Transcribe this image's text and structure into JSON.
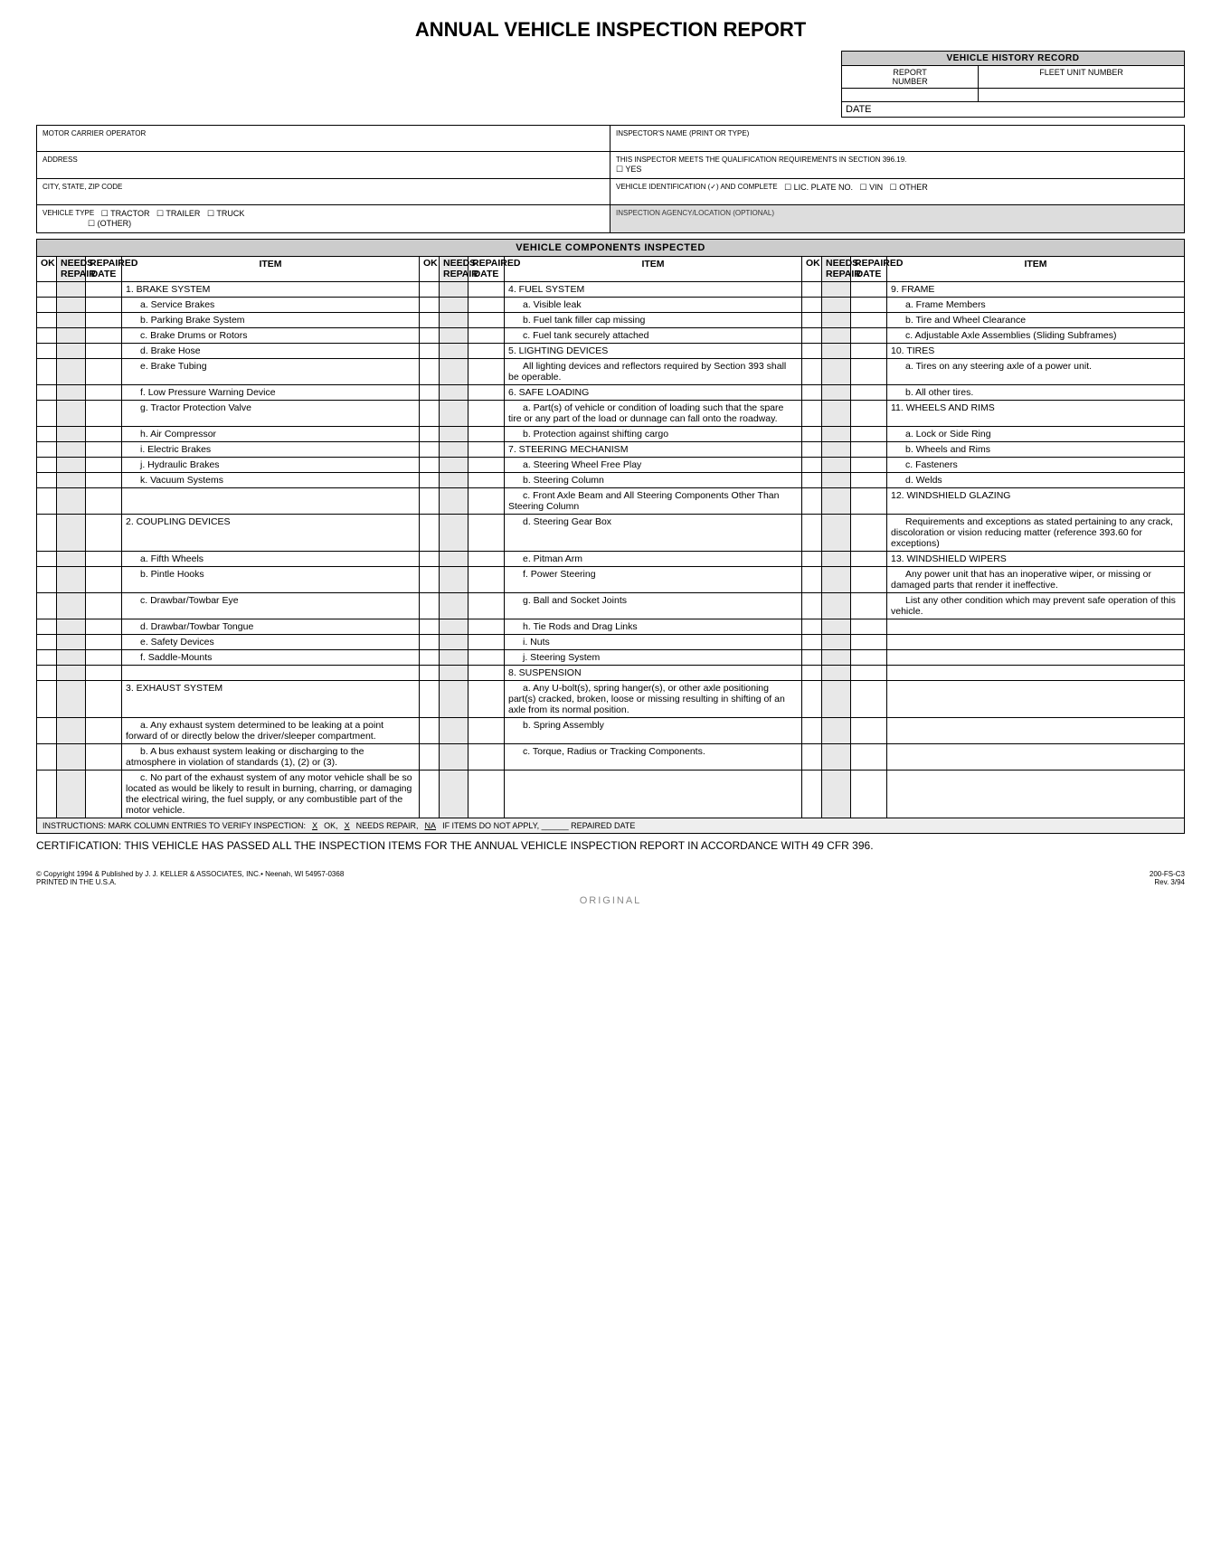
{
  "title": "ANNUAL VEHICLE INSPECTION REPORT",
  "history": {
    "header": "VEHICLE HISTORY RECORD",
    "report_number_label": "REPORT\nNUMBER",
    "fleet_unit_label": "FLEET UNIT NUMBER",
    "date_label": "DATE"
  },
  "top": {
    "motor_carrier": "MOTOR CARRIER OPERATOR",
    "inspector": "INSPECTOR'S NAME (PRINT OR TYPE)",
    "address": "ADDRESS",
    "qual": "THIS INSPECTOR MEETS THE QUALIFICATION REQUIREMENTS IN SECTION 396.19.",
    "yes": "YES",
    "city": "CITY, STATE, ZIP CODE",
    "vid": "VEHICLE IDENTIFICATION (✓) AND COMPLETE",
    "lic": "LIC. PLATE NO.",
    "vin": "VIN",
    "other_id": "OTHER",
    "vtype": "VEHICLE TYPE",
    "tractor": "TRACTOR",
    "trailer": "TRAILER",
    "truck": "TRUCK",
    "other": "(OTHER)",
    "agency": "INSPECTION AGENCY/LOCATION (OPTIONAL)"
  },
  "components_header": "VEHICLE COMPONENTS INSPECTED",
  "col_headers": {
    "ok": "OK",
    "needs": "NEEDS\nREPAIR",
    "repaired": "REPAIRED\nDATE",
    "item": "ITEM"
  },
  "col1": [
    "1. BRAKE SYSTEM",
    "a. Service Brakes",
    "b. Parking Brake System",
    "c. Brake Drums or Rotors",
    "d. Brake Hose",
    "e. Brake Tubing",
    "f. Low Pressure Warning Device",
    "g. Tractor Protection Valve",
    "h. Air Compressor",
    "i. Electric Brakes",
    "j. Hydraulic Brakes",
    "k. Vacuum Systems",
    "",
    "2. COUPLING DEVICES",
    "a. Fifth Wheels",
    "b. Pintle Hooks",
    "c. Drawbar/Towbar Eye",
    "d. Drawbar/Towbar Tongue",
    "e. Safety Devices",
    "f. Saddle-Mounts",
    "",
    "3. EXHAUST SYSTEM",
    "a. Any exhaust system determined to be leaking at a point forward of or directly below the driver/sleeper compartment.",
    "b. A bus exhaust system leaking or discharging to the atmosphere in violation of standards (1), (2) or (3).",
    "c. No part of the exhaust system of any motor vehicle shall be so located as would be likely to result in burning, charring, or damaging the electrical wiring, the fuel supply, or any combustible part of the motor vehicle."
  ],
  "col2": [
    "4. FUEL SYSTEM",
    "a. Visible leak",
    "b. Fuel tank filler cap missing",
    "c. Fuel tank securely attached",
    "5. LIGHTING DEVICES",
    "All lighting devices and reflectors required by Section 393 shall be operable.",
    "6. SAFE LOADING",
    "a. Part(s) of vehicle or condition of loading such that the spare tire or any part of the load or dunnage can fall onto the roadway.",
    "b. Protection against shifting cargo",
    "7. STEERING MECHANISM",
    "a. Steering Wheel Free Play",
    "b. Steering Column",
    "c. Front Axle Beam and All Steering Components Other Than Steering Column",
    "d. Steering Gear Box",
    "e. Pitman Arm",
    "f. Power Steering",
    "g. Ball and Socket Joints",
    "h. Tie Rods and Drag Links",
    "i. Nuts",
    "j. Steering System",
    "8. SUSPENSION",
    "a. Any U-bolt(s), spring hanger(s), or other axle positioning part(s) cracked, broken, loose or missing resulting in shifting of an axle from its normal position.",
    "b. Spring Assembly",
    "c. Torque, Radius or Tracking Components."
  ],
  "col3": [
    "9. FRAME",
    "a. Frame Members",
    "b. Tire and Wheel Clearance",
    "c. Adjustable Axle Assemblies (Sliding Subframes)",
    "10. TIRES",
    "a. Tires on any steering axle of a power unit.",
    "b. All other tires.",
    "11. WHEELS AND RIMS",
    "a. Lock or Side Ring",
    "b. Wheels and Rims",
    "c. Fasteners",
    "d. Welds",
    "12. WINDSHIELD GLAZING",
    "Requirements and exceptions as stated pertaining to any crack, discoloration or vision reducing matter (reference 393.60 for exceptions)",
    "13. WINDSHIELD WIPERS",
    "Any power unit that has an inoperative wiper, or missing or damaged parts that render it ineffective.",
    "List any other condition which may prevent safe operation of this vehicle.",
    "",
    "",
    "",
    "",
    "",
    "",
    ""
  ],
  "instructions": {
    "left": "INSTRUCTIONS: MARK COLUMN ENTRIES TO VERIFY INSPECTION:",
    "x1": "X",
    "ok": "OK,",
    "x2": "X",
    "needs": "NEEDS REPAIR,",
    "na": "NA",
    "if": "IF ITEMS DO NOT APPLY,",
    "rd": "REPAIRED DATE"
  },
  "certification": "CERTIFICATION: THIS VEHICLE HAS PASSED ALL THE INSPECTION ITEMS FOR THE ANNUAL VEHICLE INSPECTION REPORT IN ACCORDANCE WITH 49 CFR 396.",
  "footer": {
    "left": "© Copyright 1994 & Published by J. J. KELLER & ASSOCIATES, INC.• Neenah, WI 54957-0368\nPRINTED IN THE U.S.A.",
    "right": "200-FS-C3\nRev. 3/94"
  },
  "original": "ORIGINAL"
}
